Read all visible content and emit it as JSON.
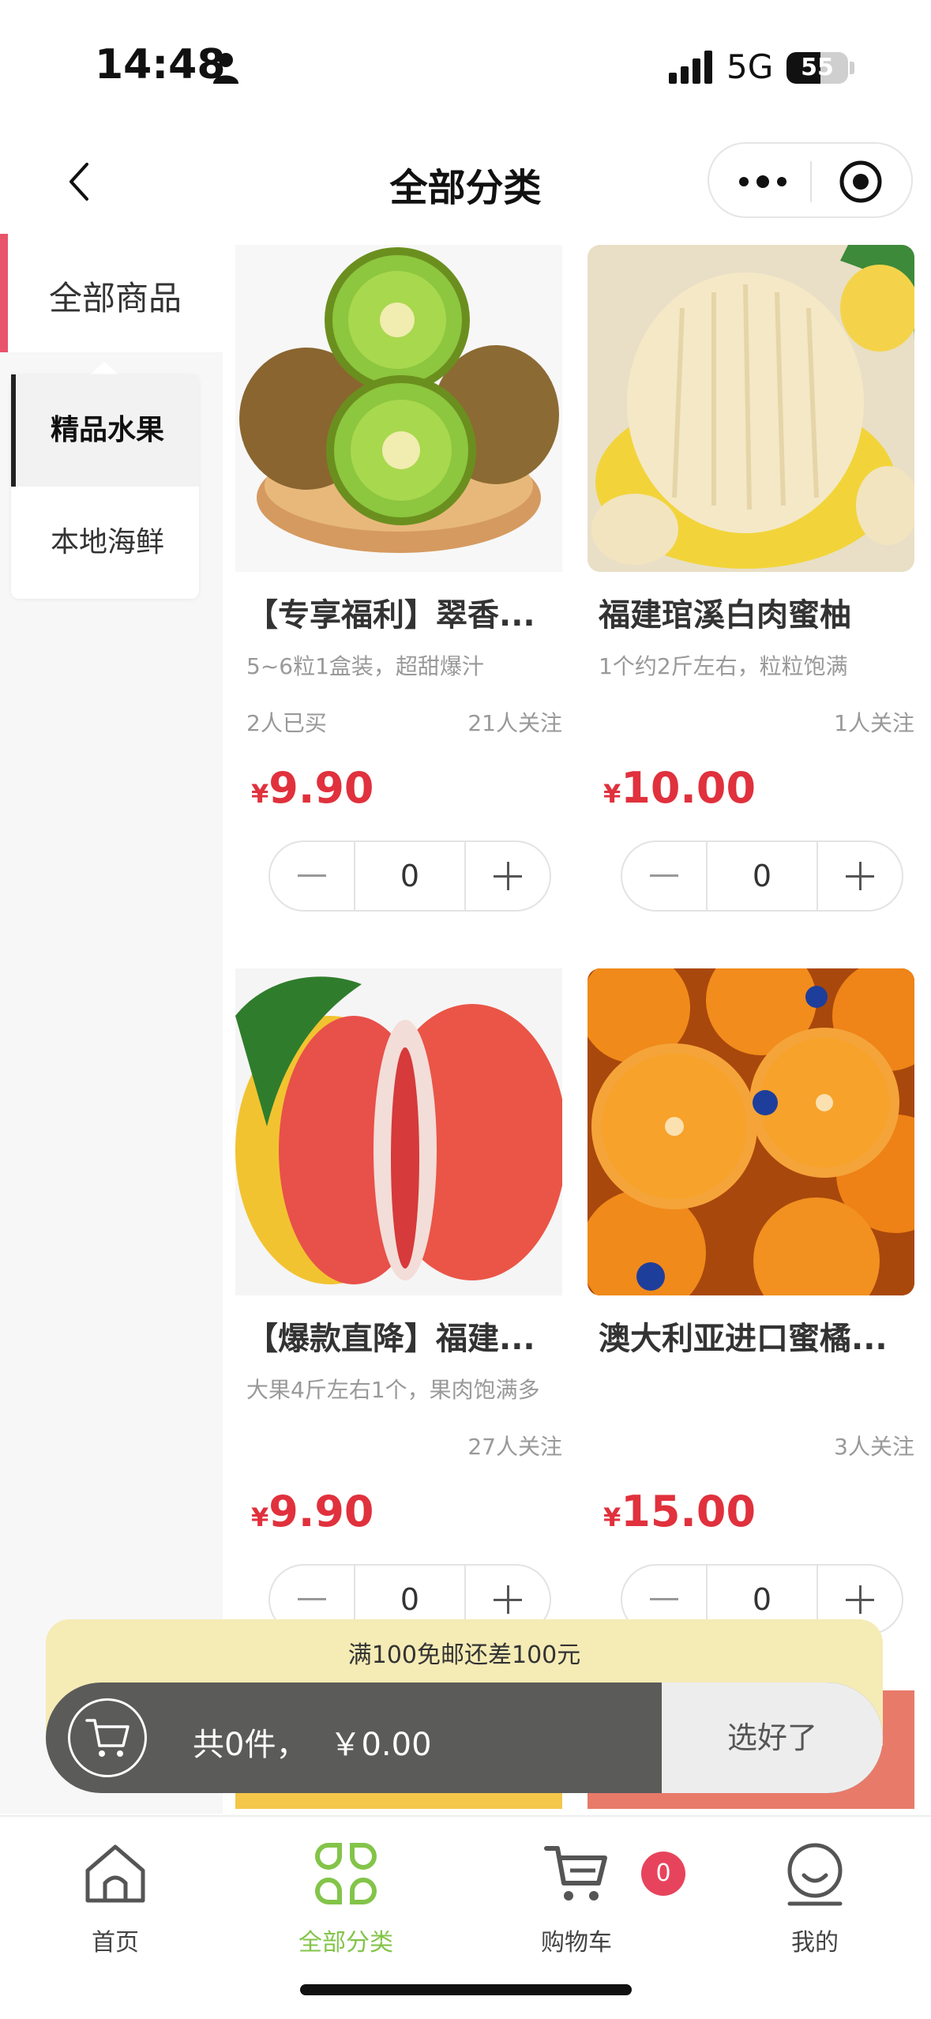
{
  "status_bar": {
    "time": "14:48",
    "network": "5G",
    "battery": "55",
    "battery_level": 0.55
  },
  "nav": {
    "title": "全部分类"
  },
  "sidebar": {
    "top_category": "全部商品",
    "subcategories": [
      {
        "label": "精品水果",
        "active": true
      },
      {
        "label": "本地海鲜",
        "active": false
      }
    ]
  },
  "products": [
    {
      "title": "【专享福利】翠香...",
      "desc": "5~6粒1盒装，超甜爆汁",
      "bought": "2人已买",
      "follow": "21人关注",
      "currency": "¥",
      "price": "9.90",
      "qty": "0",
      "image": "kiwi"
    },
    {
      "title": "福建琯溪白肉蜜柚",
      "desc": "1个约2斤左右，粒粒饱满",
      "bought": "",
      "follow": "1人关注",
      "currency": "¥",
      "price": "10.00",
      "qty": "0",
      "image": "white-pomelo"
    },
    {
      "title": "【爆款直降】福建...",
      "desc": "大果4斤左右1个，果肉饱满多",
      "bought": "",
      "follow": "27人关注",
      "currency": "¥",
      "price": "9.90",
      "qty": "0",
      "image": "red-pomelo"
    },
    {
      "title": "澳大利亚进口蜜橘...",
      "desc": "",
      "bought": "",
      "follow": "3人关注",
      "currency": "¥",
      "price": "15.00",
      "qty": "0",
      "image": "oranges"
    }
  ],
  "cart": {
    "free_shipping": "满100免邮还差100元",
    "count_text": "共0件，",
    "total_text": "￥0.00",
    "checkout_label": "选好了"
  },
  "tabs": [
    {
      "label": "首页",
      "icon": "home-icon",
      "active": false
    },
    {
      "label": "全部分类",
      "icon": "category-icon",
      "active": true
    },
    {
      "label": "购物车",
      "icon": "cart-icon",
      "active": false
    },
    {
      "label": "我的",
      "icon": "profile-icon",
      "active": false
    }
  ],
  "cart_badge": "0",
  "colors": {
    "accent_green": "#83c449",
    "price_red": "#e0313d",
    "sidebar_marker": "#e8546a",
    "badge_red": "#e8435c"
  }
}
